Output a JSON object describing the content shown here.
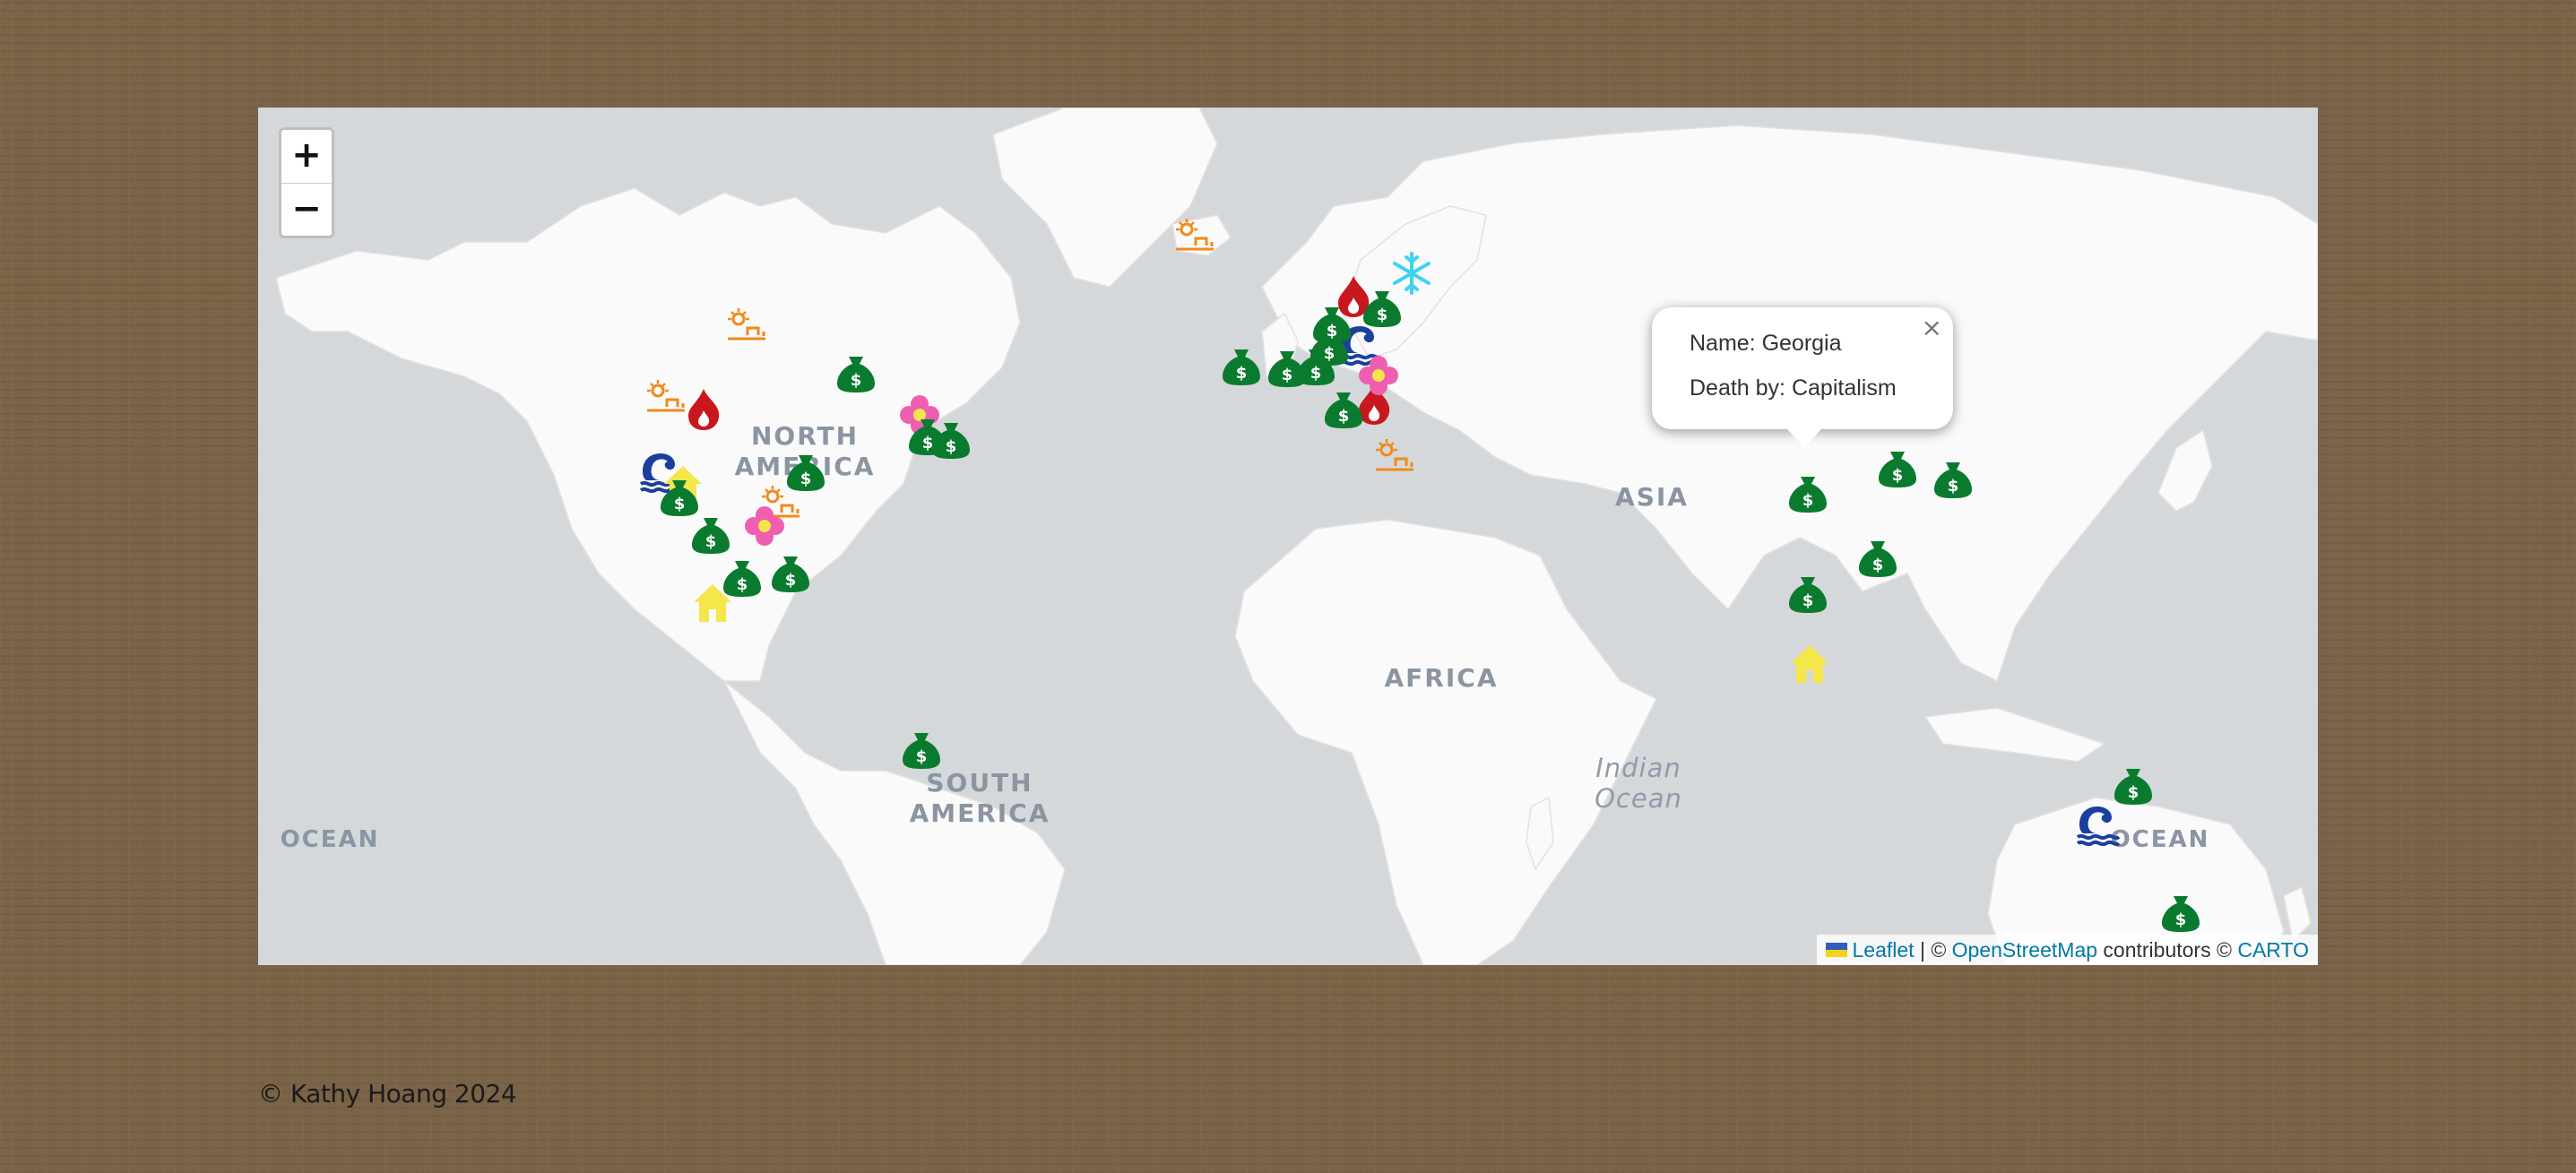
{
  "map": {
    "zoom_in_label": "+",
    "zoom_out_label": "−",
    "labels": {
      "north_america": "NORTH AMERICA",
      "south_america": "SOUTH AMERICA",
      "africa": "AFRICA",
      "asia": "ASIA",
      "indian_ocean": "Indian Ocean",
      "ocean_left": "OCEAN",
      "ocean_right": "OCEAN"
    },
    "popup": {
      "name_line": "Name: Georgia",
      "death_line": "Death by: Capitalism",
      "close_label": "×"
    },
    "attribution": {
      "leaflet": "Leaflet",
      "sep": "| ©",
      "osm": "OpenStreetMap",
      "contributors": "contributors ©",
      "carto": "CARTO"
    },
    "marker_types": {
      "capitalism": {
        "icon": "money-bag-icon",
        "color": "#0a7b2e"
      },
      "fire": {
        "icon": "fire-icon",
        "color": "#c8181e"
      },
      "drought": {
        "icon": "sun-faucet-icon",
        "color": "#f08a1c"
      },
      "cold": {
        "icon": "snowflake-icon",
        "color": "#3ed4f0"
      },
      "flood": {
        "icon": "wave-icon",
        "color": "#1b3f9e"
      },
      "house": {
        "icon": "house-icon",
        "color": "#f5e64c"
      },
      "flower": {
        "icon": "flower-icon",
        "color": "#ee5fb0"
      }
    }
  },
  "footer": {
    "text": "© Kathy Hoang 2024"
  }
}
